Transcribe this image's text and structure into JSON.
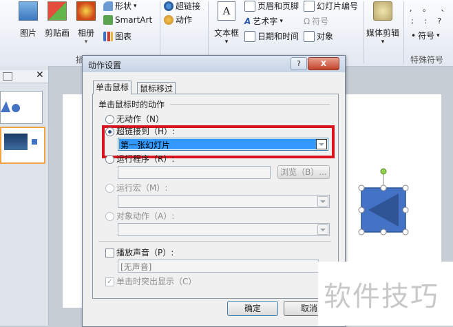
{
  "ribbon": {
    "insert_group": {
      "picture": "图片",
      "clipart": "剪贴画",
      "album": "相册",
      "shapes": "形状",
      "smartart": "SmartArt",
      "chart": "图表",
      "group_label_partial": "插"
    },
    "links_group": {
      "hyperlink": "超链接",
      "action": "动作"
    },
    "text_group": {
      "textbox": "文本框",
      "header_footer": "页眉和页脚",
      "wordart": "艺术字",
      "datetime": "日期和时间",
      "slide_number": "幻灯片编号",
      "symbol": "符号",
      "object": "对象"
    },
    "media_group": {
      "media_clip": "媒体剪辑"
    },
    "special_group": {
      "symbol": "符号",
      "group_label": "特殊符号",
      "dots_row1": ", 。 、",
      "dots_row2": "; : ?"
    }
  },
  "dialog": {
    "title": "动作设置",
    "help": "?",
    "close": "X",
    "tabs": [
      "单击鼠标",
      "鼠标移过"
    ],
    "section_title": "单击鼠标时的动作",
    "options": {
      "none": "无动作（N）",
      "hyperlink": "超链接到（H）:",
      "hyperlink_value": "第一张幻灯片",
      "run_program": "运行程序（R）:",
      "browse": "浏览（B）...",
      "run_macro": "运行宏（M）:",
      "object_action": "对象动作（A）:"
    },
    "play_sound": "播放声音（P）:",
    "sound_value": "[无声音]",
    "highlight": "单击时突出显示（C）",
    "ok": "确定",
    "cancel": "取消"
  },
  "watermark": "软件技巧",
  "colors": {
    "highlight_box": "#d9141e",
    "selected_field": "#3399ff",
    "shape_fill": "#4472c4"
  }
}
